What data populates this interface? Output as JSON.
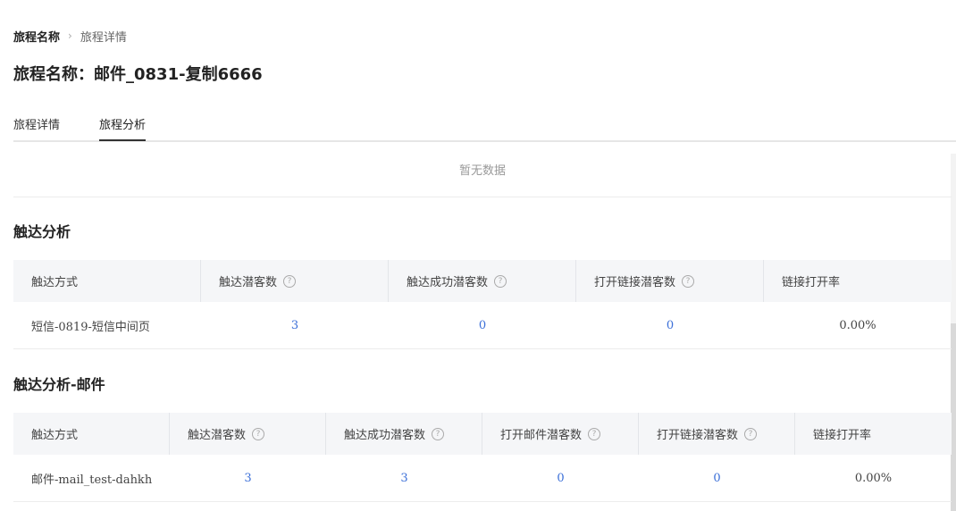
{
  "breadcrumb": {
    "root": "旅程名称",
    "separator": "›",
    "current": "旅程详情"
  },
  "page_title": "旅程名称：邮件_0831-复制6666",
  "tabs": [
    {
      "label": "旅程详情"
    },
    {
      "label": "旅程分析",
      "active": true
    }
  ],
  "empty": {
    "text": "暂无数据"
  },
  "reach": {
    "title": "触达分析",
    "columns": [
      "触达方式",
      "触达潜客数",
      "触达成功潜客数",
      "打开链接潜客数",
      "链接打开率"
    ],
    "rows": [
      {
        "method": "短信-0819-短信中间页",
        "reach": "3",
        "success": "0",
        "open_link": "0",
        "rate": "0.00%"
      }
    ]
  },
  "mail": {
    "title": "触达分析-邮件",
    "columns": [
      "触达方式",
      "触达潜客数",
      "触达成功潜客数",
      "打开邮件潜客数",
      "打开链接潜客数",
      "链接打开率"
    ],
    "rows": [
      {
        "method": "邮件-mail_test-dahkh",
        "reach": "3",
        "success": "3",
        "open_mail": "0",
        "open_link": "0",
        "rate": "0.00%"
      }
    ]
  },
  "help_icon": "?",
  "colors": {
    "link_blue": "#3b6fd8",
    "header_bg": "#f5f6f8"
  }
}
